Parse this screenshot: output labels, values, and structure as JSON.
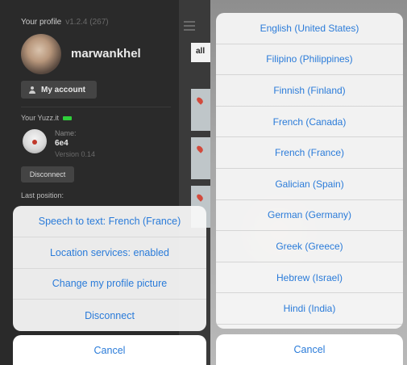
{
  "left": {
    "profile": {
      "title": "Your profile",
      "version": "v1.2.4 (267)",
      "username": "marwankhel",
      "account_button": "My account"
    },
    "device": {
      "section_title": "Your Yuzz.it",
      "name_label": "Name:",
      "name_value": "6e4",
      "version": "Version 0.14",
      "disconnect_button": "Disconnect",
      "last_position_label": "Last position:"
    },
    "tab_label": "all",
    "action_sheet": {
      "items": [
        "Speech to text: French (France)",
        "Location services: enabled",
        "Change my profile picture",
        "Disconnect"
      ],
      "cancel": "Cancel"
    }
  },
  "right": {
    "languages": [
      "English (United States)",
      "Filipino (Philippines)",
      "Finnish (Finland)",
      "French (Canada)",
      "French (France)",
      "Galician (Spain)",
      "German (Germany)",
      "Greek (Greece)",
      "Hebrew (Israel)",
      "Hindi (India)"
    ],
    "cancel": "Cancel"
  },
  "colors": {
    "accent": "#2a7bd9",
    "battery": "#2fcf3a"
  }
}
